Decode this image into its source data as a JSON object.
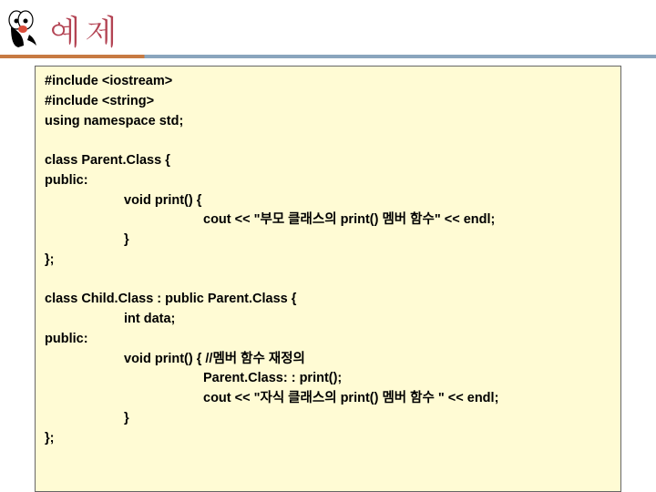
{
  "header": {
    "title": "예제"
  },
  "code": {
    "l1": "#include <iostream>",
    "l2": "#include <string>",
    "l3": "using namespace std;",
    "l4": "class Parent.Class {",
    "l5": "public:",
    "l6": "void print() {",
    "l7": "cout << \"부모 클래스의 print() 멤버 함수\" << endl;",
    "l8": "}",
    "l9": "};",
    "l10": "class Child.Class : public Parent.Class {",
    "l11": "int data;",
    "l12": "public:",
    "l13": "void print() { //멤버 함수 재정의",
    "l14": "Parent.Class: : print();",
    "l15": "cout << \"자식 클래스의 print() 멤버 함수 \" << endl;",
    "l16": "}",
    "l17": "};"
  }
}
